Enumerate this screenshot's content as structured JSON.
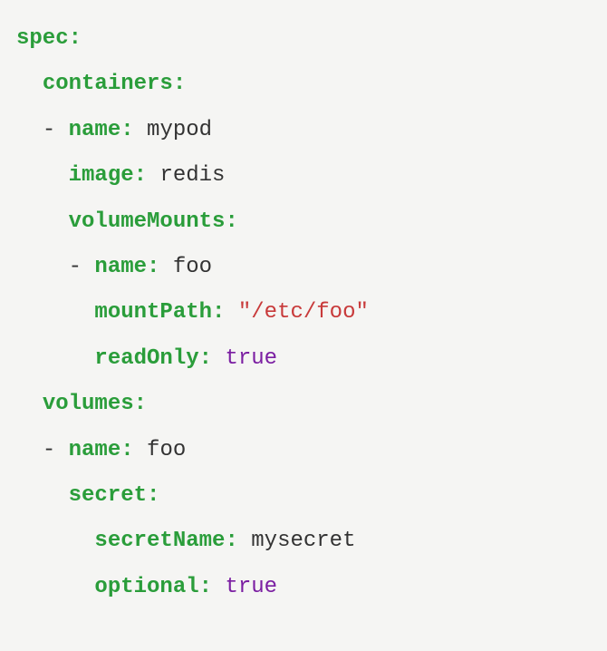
{
  "k": {
    "spec": "spec:",
    "containers": "containers:",
    "name": "name:",
    "image": "image:",
    "volumeMounts": "volumeMounts:",
    "mountPath": "mountPath:",
    "readOnly": "readOnly:",
    "volumes": "volumes:",
    "secret": "secret:",
    "secretName": "secretName:",
    "optional": "optional:"
  },
  "v": {
    "mypod": "mypod",
    "redis": "redis",
    "foo": "foo",
    "etcfoo": "\"/etc/foo\"",
    "true": "true",
    "mysecret": "mysecret"
  },
  "dash": "-"
}
